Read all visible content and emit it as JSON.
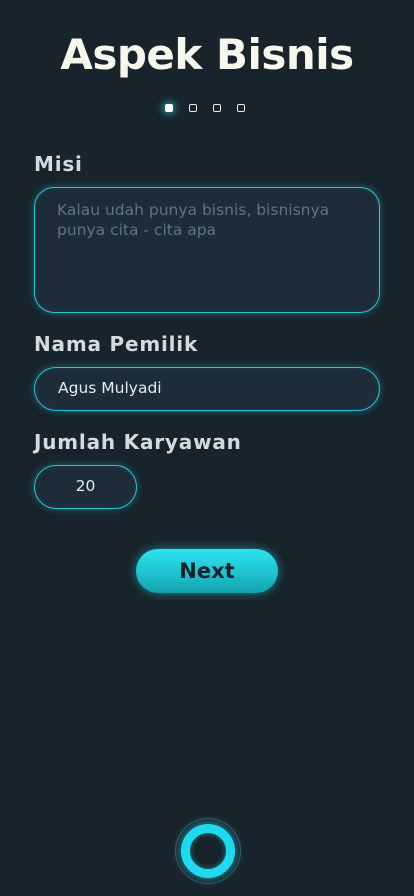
{
  "header": {
    "title": "Aspek Bisnis"
  },
  "steps": {
    "total": 4,
    "current": 1
  },
  "form": {
    "misi": {
      "label": "Misi",
      "value": "",
      "placeholder": "Kalau udah punya bisnis, bisnisnya punya cita - cita apa"
    },
    "nama_pemilik": {
      "label": "Nama Pemilik",
      "value": "Agus Mulyadi"
    },
    "jumlah_karyawan": {
      "label": "Jumlah Karyawan",
      "value": "20"
    }
  },
  "actions": {
    "next_label": "Next"
  },
  "colors": {
    "background": "#18232b",
    "accent": "#27c7d6",
    "title": "#f6f8ee"
  }
}
